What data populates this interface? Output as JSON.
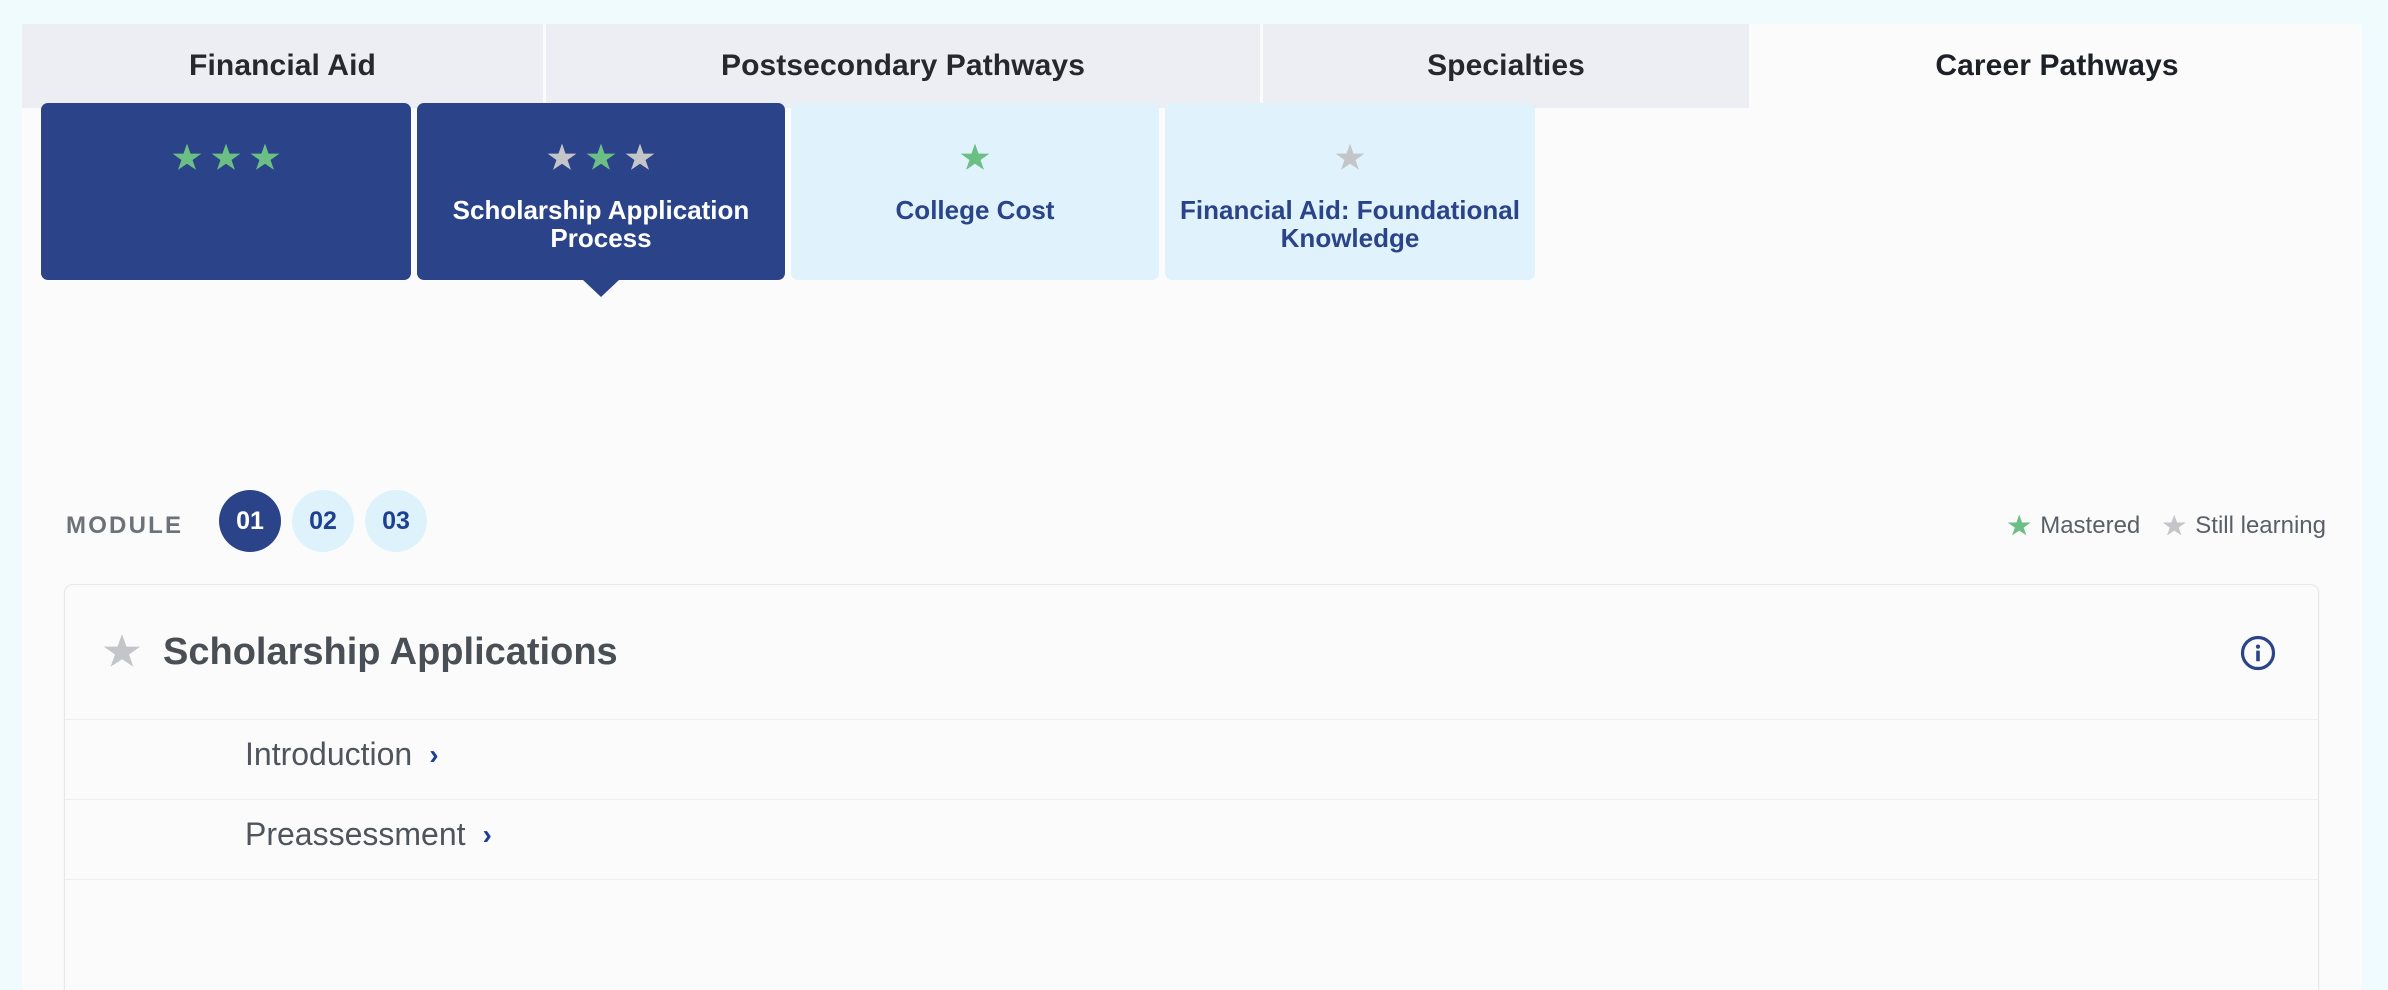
{
  "tabs": [
    {
      "label": "Financial Aid",
      "active": false
    },
    {
      "label": "Postsecondary Pathways",
      "active": false
    },
    {
      "label": "Specialties",
      "active": false
    },
    {
      "label": "Career Pathways",
      "active": true
    }
  ],
  "cards": [
    {
      "title": "",
      "stars": [
        "green",
        "green",
        "green"
      ],
      "selected": true,
      "pointer": false
    },
    {
      "title": "Scholarship Application Process",
      "stars": [
        "gray",
        "green",
        "gray"
      ],
      "selected": true,
      "pointer": true
    },
    {
      "title": "College Cost",
      "stars": [
        "green"
      ],
      "selected": false,
      "pointer": false
    },
    {
      "title": "Financial Aid: Foundational Knowledge",
      "stars": [
        "gray"
      ],
      "selected": false,
      "pointer": false
    }
  ],
  "module": {
    "label": "MODULE",
    "pills": [
      {
        "number": "01",
        "active": true
      },
      {
        "number": "02",
        "active": false
      },
      {
        "number": "03",
        "active": false
      }
    ]
  },
  "legend": {
    "mastered_label": "Mastered",
    "still_learning_label": "Still learning"
  },
  "panel": {
    "star_state": "gray",
    "title": "Scholarship Applications",
    "info_icon": "info-circle-icon",
    "items": [
      {
        "label": "Introduction",
        "chevron": "›"
      },
      {
        "label": "Preassessment",
        "chevron": "›"
      }
    ]
  },
  "colors": {
    "brand_navy": "#2b4389",
    "mastered_green": "#6cbf84",
    "still_learning_gray": "#c3c5c8",
    "card_light_blue": "#e0f3fc",
    "pill_light_blue": "#ddf2fb",
    "tab_inactive": "#eceef4",
    "page_background": "#effbfd"
  }
}
